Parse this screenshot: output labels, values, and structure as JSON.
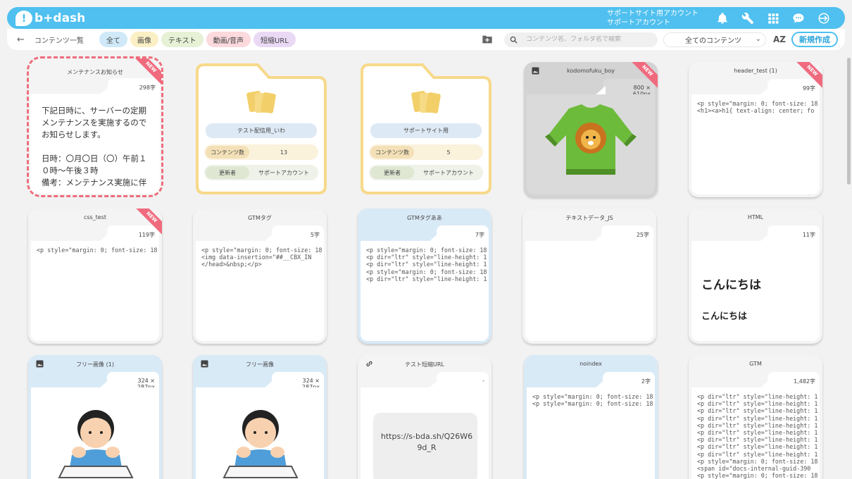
{
  "header": {
    "logo_text": "b+dash",
    "logo_mark": "!",
    "account_line1": "サポートサイト用アカウント",
    "account_line2": "サポートアカウント",
    "icons": [
      "bell-icon",
      "wrench-icon",
      "grid-icon",
      "chat-icon",
      "logout-icon"
    ]
  },
  "toolbar": {
    "back_glyph": "←",
    "breadcrumb": "コンテンツ一覧",
    "chips": [
      "全て",
      "画像",
      "テキスト",
      "動画/音声",
      "短縮URL"
    ],
    "search_placeholder": "コンテンツ名、フォルダ名で検索",
    "filter_value": "全てのコンテンツ",
    "sort_label": "AZ",
    "new_button": "新規作成"
  },
  "colors": {
    "accent": "#4fc0ef",
    "new_ribbon": "#f06a7e",
    "folder": "#f7d98a"
  },
  "new_label": "NEW",
  "cards": {
    "notice": {
      "title": "メンテナンスお知らせ",
      "count": "298字",
      "body": "下記日時に、サーバーの定期\nメンテナンスを実施するので\nお知らせします。\n\n日時：〇月〇日（〇）午前１\n０時～午後３時\n備考：メンテナンス実施に伴"
    },
    "folder1": {
      "name": "テスト配信用_いわ",
      "count_label": "コンテンツ数",
      "count": "13",
      "updater_label": "更新者",
      "updater": "サポートアカウント"
    },
    "folder2": {
      "name": "サポートサイト用",
      "count_label": "コンテンツ数",
      "count": "5",
      "updater_label": "更新者",
      "updater": "サポートアカウント"
    },
    "kodomo": {
      "title": "kodomofuku_boy",
      "count": "800 × 610px"
    },
    "header_test": {
      "title": "header_test (1)",
      "count": "99字",
      "code": "<p style=\"margin: 0; font-size: 18\n<h1><a>h1{ text-align: center; fo"
    },
    "css_test": {
      "title": "css_test",
      "count": "119字",
      "code": "<p style=\"margin: 0; font-size: 18"
    },
    "gtm_tag": {
      "title": "GTMタグ",
      "count": "5字",
      "code": "<p style=\"margin: 0; font-size: 18\n<img data-insertion=\"##__CBX_IN\n</head>&nbsp;</p>"
    },
    "gtm_tag_aa": {
      "title": "GTMタグああ",
      "count": "7字",
      "code": "<p style=\"margin: 0; font-size: 18\n<p dir=\"ltr\" style=\"line-height: 1\n<p dir=\"ltr\" style=\"line-height: 1\n<p style=\"margin: 0; font-size: 18\n<p dir=\"ltr\" style=\"line-height: 1"
    },
    "text_js": {
      "title": "テキストデータ_JS",
      "count": "25字"
    },
    "html": {
      "title": "HTML",
      "count": "11字",
      "hello1": "こんにちは",
      "hello2": "こんにちは"
    },
    "free_img1": {
      "title": "フリー画像 (1)",
      "count": "324 × 287px"
    },
    "free_img2": {
      "title": "フリー画像",
      "count": "324 × 287px"
    },
    "short_url": {
      "title": "テスト短縮URL",
      "count": "-",
      "url": "https://s-bda.sh/Q26W6\n9d_R"
    },
    "noindex": {
      "title": "noindex",
      "count": "2字",
      "code": "<p style=\"margin: 0; font-size: 18\n<p style=\"margin: 0; font-size: 18"
    },
    "gtm": {
      "title": "GTM",
      "count": "1,482字",
      "code": "<p dir=\"ltr\" style=\"line-height: 1\n<p dir=\"ltr\" style=\"line-height: 1\n<p dir=\"ltr\" style=\"line-height: 1\n<p dir=\"ltr\" style=\"line-height: 1\n<p dir=\"ltr\" style=\"line-height: 1\n<p dir=\"ltr\" style=\"line-height: 1\n<p dir=\"ltr\" style=\"line-height: 1\n<p dir=\"ltr\" style=\"line-height: 1\n<p dir=\"ltr\" style=\"line-height: 1\n<p style=\"margin: 0; font-size: 18\n<span id=\"docs-internal-guid-390\n<p style=\"margin: 0; font-size: 18"
    }
  }
}
